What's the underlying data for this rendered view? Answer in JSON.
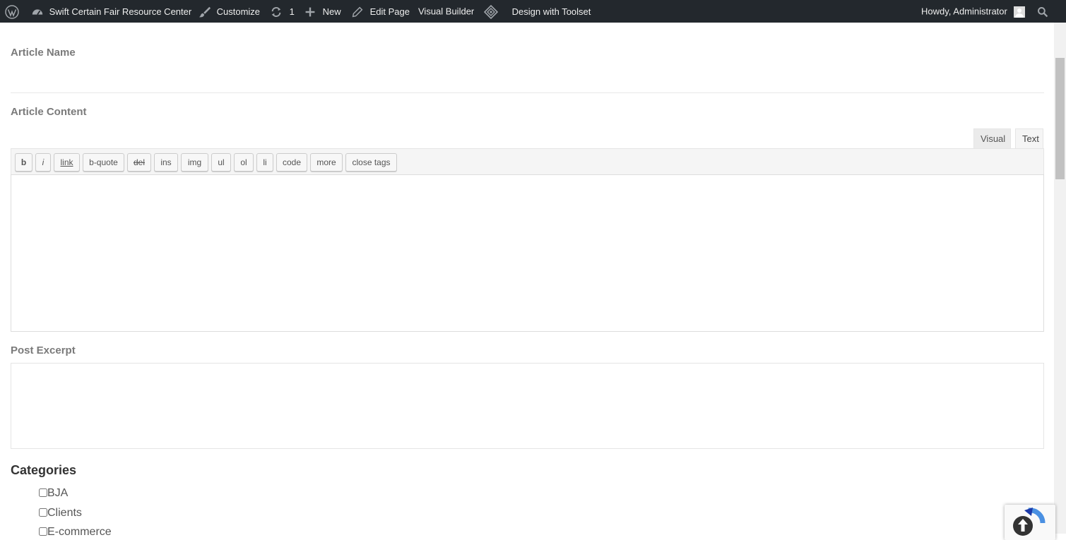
{
  "admin_bar": {
    "site_name": "Swift Certain Fair Resource Center",
    "customize": "Customize",
    "updates_count": "1",
    "new": "New",
    "edit_page": "Edit Page",
    "visual_builder": "Visual Builder",
    "design_with_toolset": "Design with Toolset",
    "greeting": "Howdy, Administrator"
  },
  "form": {
    "article_name_label": "Article Name",
    "article_name_value": "",
    "article_content_label": "Article Content",
    "editor_tabs": {
      "visual": "Visual",
      "text": "Text",
      "active": "text"
    },
    "quicktags": [
      {
        "label": "b",
        "name": "qt-bold-button"
      },
      {
        "label": "i",
        "name": "qt-italic-button"
      },
      {
        "label": "link",
        "name": "qt-link-button"
      },
      {
        "label": "b-quote",
        "name": "qt-blockquote-button"
      },
      {
        "label": "del",
        "name": "qt-del-button"
      },
      {
        "label": "ins",
        "name": "qt-ins-button"
      },
      {
        "label": "img",
        "name": "qt-img-button"
      },
      {
        "label": "ul",
        "name": "qt-ul-button"
      },
      {
        "label": "ol",
        "name": "qt-ol-button"
      },
      {
        "label": "li",
        "name": "qt-li-button"
      },
      {
        "label": "code",
        "name": "qt-code-button"
      },
      {
        "label": "more",
        "name": "qt-more-button"
      },
      {
        "label": "close tags",
        "name": "qt-close-tags-button"
      }
    ],
    "article_content_value": "",
    "post_excerpt_label": "Post Excerpt",
    "post_excerpt_value": "",
    "categories_heading": "Categories",
    "categories": [
      {
        "label": "BJA",
        "checked": false
      },
      {
        "label": "Clients",
        "checked": false
      },
      {
        "label": "E-commerce",
        "checked": false
      }
    ]
  },
  "colors": {
    "admin_bar_bg": "#23282d",
    "admin_bar_text": "#eeeeee",
    "label_gray": "#7a7a7a",
    "recaptcha_blue": "#1c3aa9"
  }
}
